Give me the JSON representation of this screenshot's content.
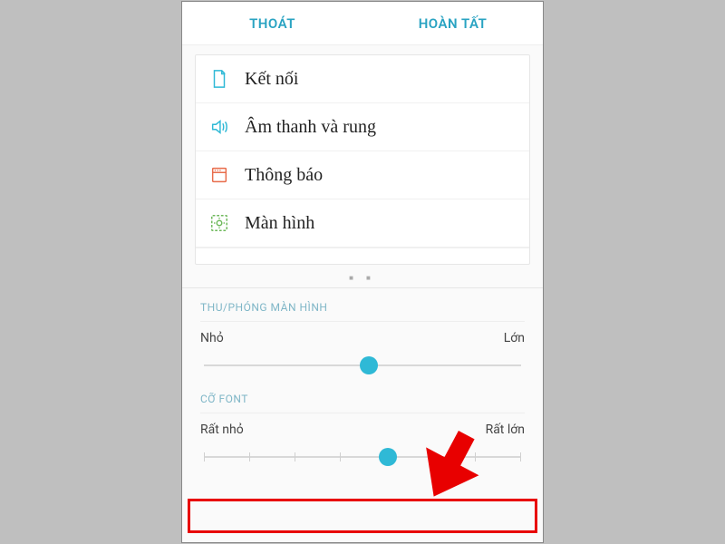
{
  "topbar": {
    "exit_label": "THOÁT",
    "done_label": "HOÀN TẤT"
  },
  "preview": {
    "items": [
      {
        "label": "Kết nối",
        "icon": "page-icon",
        "color": "#2fb9d6"
      },
      {
        "label": "Âm thanh và rung",
        "icon": "speaker-icon",
        "color": "#2fb9d6"
      },
      {
        "label": "Thông báo",
        "icon": "notify-icon",
        "color": "#e86b4a"
      },
      {
        "label": "Màn hình",
        "icon": "display-icon",
        "color": "#6fb95c"
      }
    ],
    "cutoff_label": ""
  },
  "zoom": {
    "title": "THU/PHÓNG MÀN HÌNH",
    "min_label": "Nhỏ",
    "max_label": "Lớn",
    "value_pct": 52
  },
  "font": {
    "title": "CỠ FONT",
    "min_label": "Rất nhỏ",
    "max_label": "Rất lớn",
    "value_pct": 58,
    "tick_count": 8
  },
  "colors": {
    "accent": "#2fb9d6",
    "highlight": "#e80000"
  }
}
